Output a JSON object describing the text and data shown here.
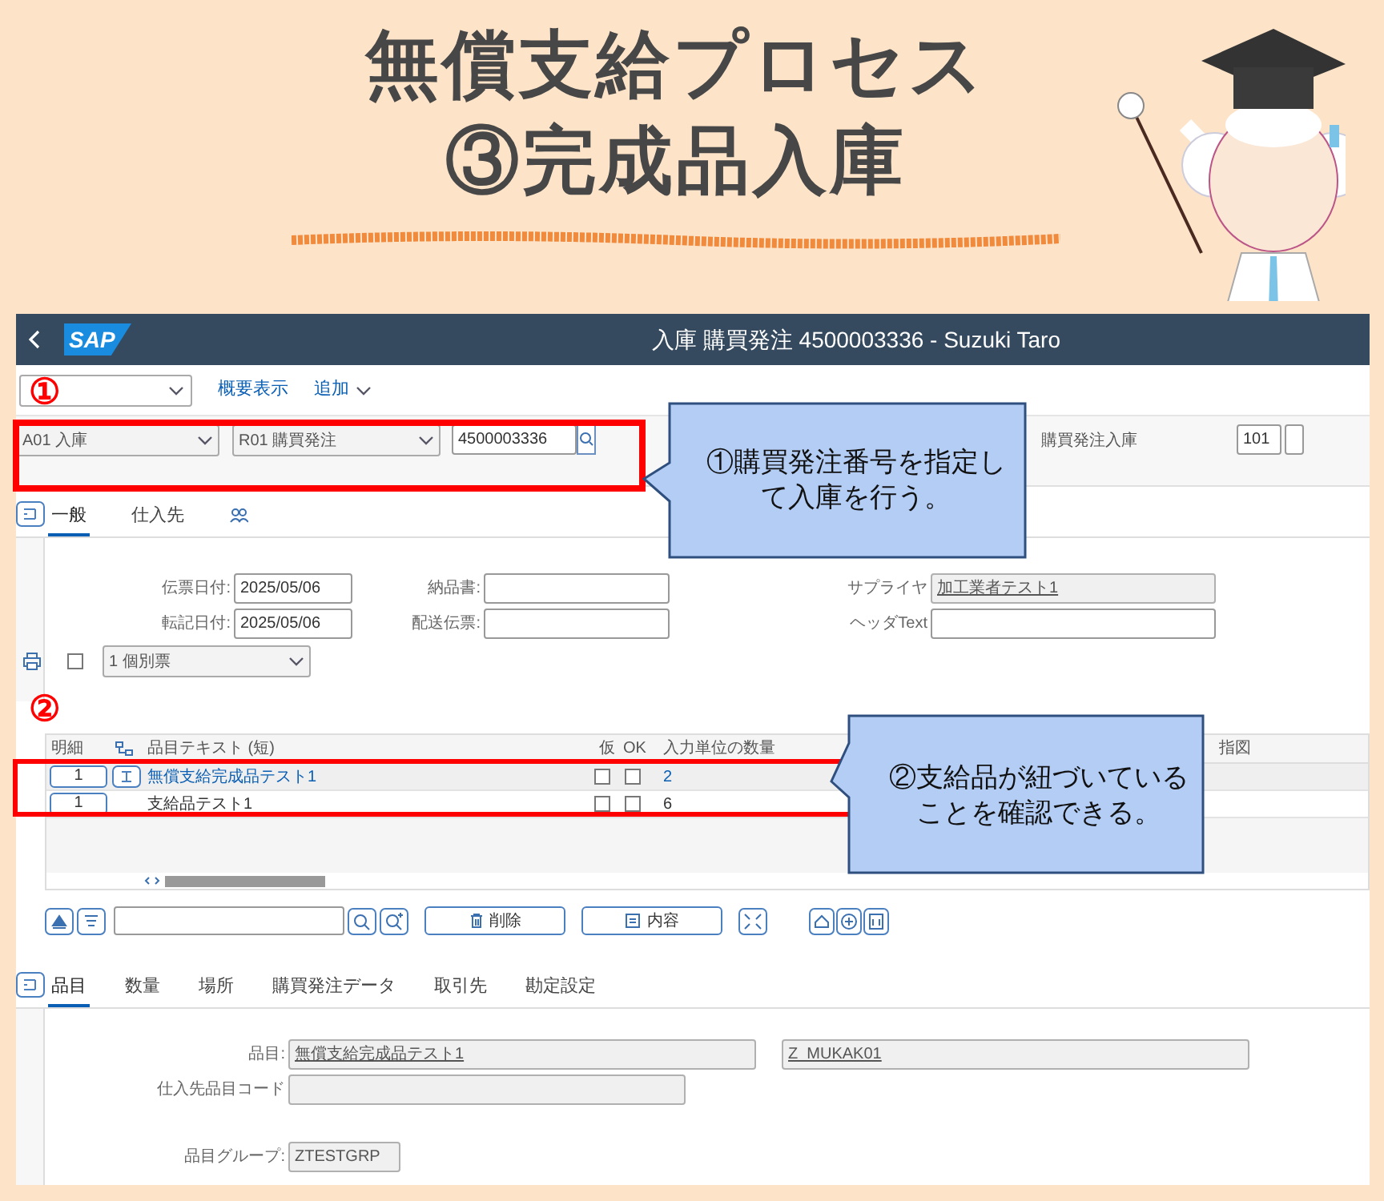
{
  "banner": {
    "title_lines": [
      "無償支給プロセス",
      "③完成品入庫"
    ]
  },
  "app": {
    "logo": "SAP",
    "title": "入庫 購買発注 4500003336 - Suzuki Taro"
  },
  "toolbar": {
    "links": [
      {
        "label": "概要表示",
        "kind": "link"
      },
      {
        "label": "追加",
        "kind": "menu"
      }
    ]
  },
  "header": {
    "transaction": "A01 入庫",
    "reference": "R01 購買発注",
    "po_number": "4500003336",
    "movement_label": "購買発注入庫",
    "movement_type": "101"
  },
  "header_tabs": [
    {
      "kind": "text",
      "label": "一般",
      "selected": true
    },
    {
      "kind": "text",
      "label": "仕入先",
      "selected": false
    },
    {
      "kind": "people",
      "selected": false
    }
  ],
  "header_form": {
    "field_columns": [
      [
        {
          "label": "伝票日付:",
          "value": "2025/05/06",
          "readonly": false
        },
        {
          "label": "転記日付:",
          "value": "2025/05/06",
          "readonly": false
        }
      ],
      [
        {
          "label": "納品書:",
          "readonly": false
        },
        {
          "label": "配送伝票:",
          "readonly": false
        }
      ],
      [
        {
          "label": "サプライヤ",
          "value": "加工業者テスト1",
          "readonly": true
        },
        {
          "label": "ヘッダText",
          "readonly": false
        }
      ]
    ],
    "print_checked": false,
    "output": "1 個別票"
  },
  "markers": [
    {
      "text": "①"
    },
    {
      "text": "②"
    }
  ],
  "items_table": {
    "columns": [
      {
        "label": "明細",
        "kind": "text"
      },
      {
        "kind": "icon"
      },
      {
        "label": "品目テキスト (短)",
        "kind": "text"
      },
      {
        "label": "仮",
        "kind": "text"
      },
      {
        "label": "OK",
        "kind": "text"
      },
      {
        "label": "入力単位の数量",
        "kind": "text"
      },
      {
        "label": "指図",
        "kind": "text"
      }
    ],
    "rows": [
      {
        "detail": "1",
        "kind": "main",
        "text": "無償支給完成品テスト1",
        "flag": false,
        "ok": false,
        "quantity": "2"
      },
      {
        "detail": "1",
        "kind": "component",
        "text": "支給品テスト1",
        "flag": false,
        "ok": false,
        "quantity": "6"
      }
    ]
  },
  "item_buttons": [
    {
      "kind": "delete",
      "label": "削除"
    },
    {
      "kind": "content",
      "label": "内容"
    }
  ],
  "item_tabs": [
    {
      "label": "品目",
      "selected": true
    },
    {
      "label": "数量",
      "selected": false
    },
    {
      "label": "場所",
      "selected": false
    },
    {
      "label": "購買発注データ",
      "selected": false
    },
    {
      "label": "取引先",
      "selected": false
    },
    {
      "label": "勘定設定",
      "selected": false
    }
  ],
  "item_form": {
    "material_label": "品目:",
    "material": "無償支給完成品テスト1",
    "material_code": "Z_MUKAK01",
    "vendor_code_label": "仕入先品目コード",
    "group_label": "品目グループ:",
    "group": "ZTESTGRP"
  },
  "callouts": [
    {
      "text": "①購買発注番号を指定して入庫を行う。"
    },
    {
      "text": "②支給品が紐づいていることを確認できる。"
    }
  ]
}
